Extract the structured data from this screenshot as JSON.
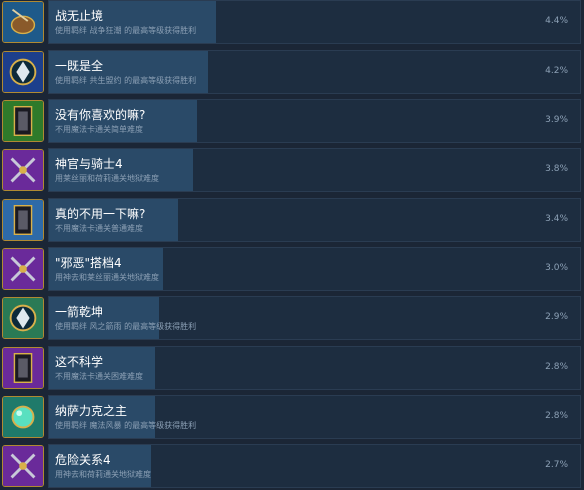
{
  "achievements": [
    {
      "title": "战无止境",
      "desc": "使用羁绊 战争狂潮 的最高等级获得胜利",
      "percent": "4.4%",
      "rate": 4.4,
      "icon": "war-drum-icon",
      "bg": "#1e5a8a"
    },
    {
      "title": "一既是全",
      "desc": "使用羁绊 共生盟约 的最高等级获得胜利",
      "percent": "4.2%",
      "rate": 4.2,
      "icon": "blue-hand-crest-icon",
      "bg": "#1d3f8c"
    },
    {
      "title": "没有你喜欢的嘛?",
      "desc": "不用魔法卡通关简单难度",
      "percent": "3.9%",
      "rate": 3.9,
      "icon": "green-card-frame-icon",
      "bg": "#2f7a2a"
    },
    {
      "title": "神官与骑士4",
      "desc": "用莱丝丽和荷莉通关地狱难度",
      "percent": "3.8%",
      "rate": 3.8,
      "icon": "crossed-swords-icon",
      "bg": "#6a2a9a"
    },
    {
      "title": "真的不用一下嘛?",
      "desc": "不用魔法卡通关普通难度",
      "percent": "3.4%",
      "rate": 3.4,
      "icon": "blue-card-frame-icon",
      "bg": "#2e6aa8"
    },
    {
      "title": "\"邪恶\"搭档4",
      "desc": "用神去和莱丝丽通关地狱难度",
      "percent": "3.0%",
      "rate": 3.0,
      "icon": "purple-weapons-icon",
      "bg": "#6a2a9a"
    },
    {
      "title": "一箭乾坤",
      "desc": "使用羁绊 风之箭雨 的最高等级获得胜利",
      "percent": "2.9%",
      "rate": 2.9,
      "icon": "wind-arrow-crest-icon",
      "bg": "#2a7a55"
    },
    {
      "title": "这不科学",
      "desc": "不用魔法卡通关困难难度",
      "percent": "2.8%",
      "rate": 2.8,
      "icon": "purple-card-frame-icon",
      "bg": "#6a2a9a"
    },
    {
      "title": "纳萨力克之主",
      "desc": "使用羁绊 魔法风暴 的最高等级获得胜利",
      "percent": "2.8%",
      "rate": 2.8,
      "icon": "magic-orb-icon",
      "bg": "#1f7a6a"
    },
    {
      "title": "危险关系4",
      "desc": "用神去和荷莉通关地狱难度",
      "percent": "2.7%",
      "rate": 2.7,
      "icon": "purple-daggers-icon",
      "bg": "#6a2a9a"
    }
  ]
}
